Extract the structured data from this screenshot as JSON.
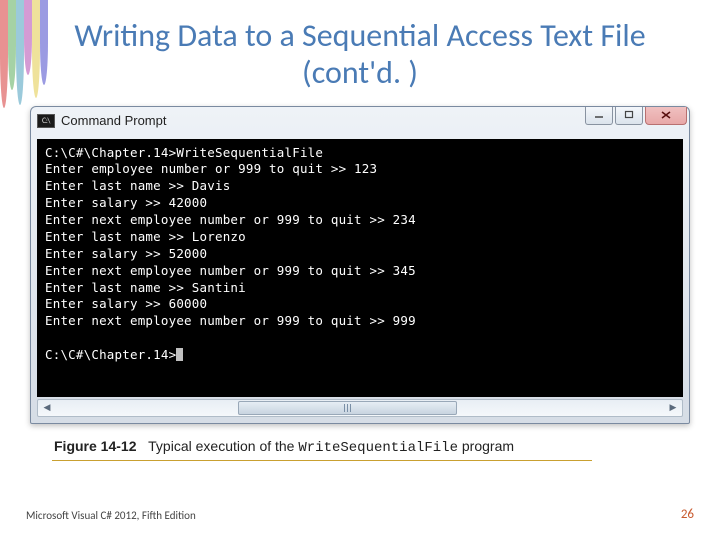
{
  "slide": {
    "title": "Writing Data to a Sequential Access Text File (cont'd. )"
  },
  "window": {
    "title": "Command Prompt",
    "icon_label": "C:\\"
  },
  "console": {
    "lines": [
      "C:\\C#\\Chapter.14>WriteSequentialFile",
      "Enter employee number or 999 to quit >> 123",
      "Enter last name >> Davis",
      "Enter salary >> 42000",
      "Enter next employee number or 999 to quit >> 234",
      "Enter last name >> Lorenzo",
      "Enter salary >> 52000",
      "Enter next employee number or 999 to quit >> 345",
      "Enter last name >> Santini",
      "Enter salary >> 60000",
      "Enter next employee number or 999 to quit >> 999",
      "",
      "C:\\C#\\Chapter.14>"
    ]
  },
  "caption": {
    "label": "Figure 14-12",
    "prefix": "Typical execution of the ",
    "program": "WriteSequentialFile",
    "suffix": " program"
  },
  "footer": {
    "left": "Microsoft Visual C# 2012, Fifth Edition",
    "page": "26"
  }
}
